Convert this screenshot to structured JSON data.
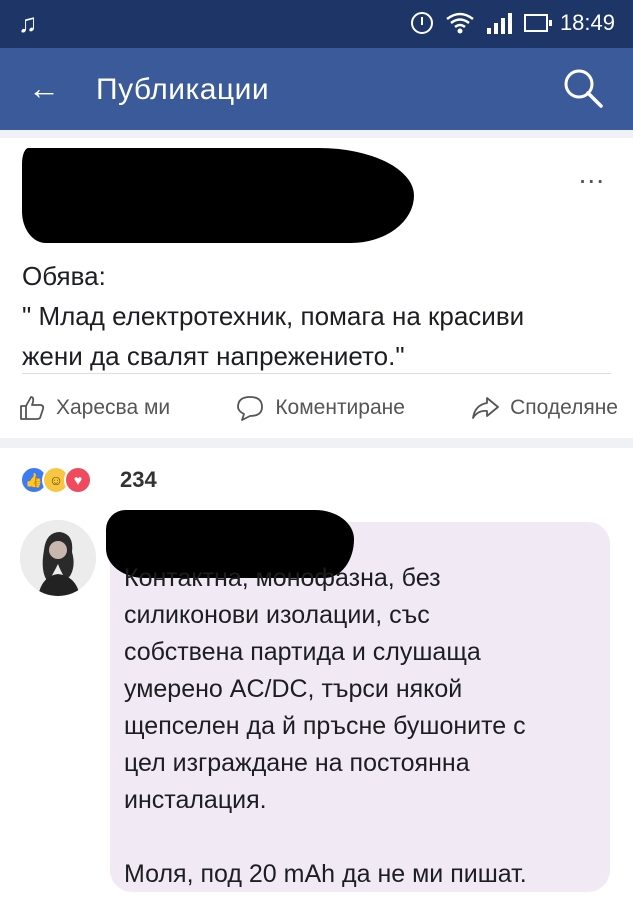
{
  "status_bar": {
    "time": "18:49",
    "icons": [
      "music-note-icon",
      "alarm-icon",
      "wifi-icon",
      "signal-icon",
      "battery-icon"
    ]
  },
  "app_bar": {
    "back_icon": "arrow-left-icon",
    "title": "Публикации",
    "search_icon": "search-icon"
  },
  "post": {
    "more_label": "...",
    "text_line1": "Обява:",
    "text_line2": "\" Млад електротехник, помага на красиви",
    "text_line3": "жени да свалят напрежението.\"",
    "actions": {
      "like": "Харесва ми",
      "comment": "Коментиране",
      "share": "Споделяне"
    }
  },
  "reactions": {
    "icons": [
      "like-reaction-icon",
      "haha-reaction-icon",
      "love-reaction-icon"
    ],
    "count": "234"
  },
  "comment": {
    "text": "Контактна, монофазна, без\nсиликонови изолации, със\nсобствена партида и слушаща\nумерено AC/DC, търси някой\nщепселен да й пръсне бушоните с\nцел изграждане на постоянна\nинсталация.\n\nМоля, под 20 mAh да не ми пишат."
  },
  "colors": {
    "status_bar": "#1d3567",
    "app_bar": "#3b5a9a",
    "bubble": "#f1e9f4"
  }
}
